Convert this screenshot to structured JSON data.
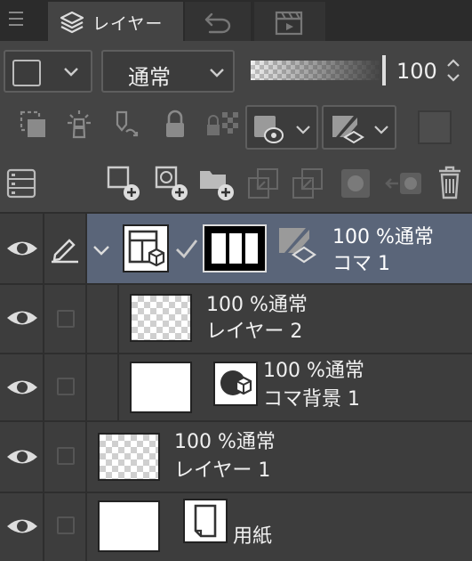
{
  "tabs": [
    {
      "label": "レイヤー",
      "icon": "layers-icon",
      "active": true
    },
    {
      "label": "",
      "icon": "history-icon",
      "active": false
    },
    {
      "label": "",
      "icon": "animation-icon",
      "active": false
    }
  ],
  "blend_mode": "通常",
  "opacity_value": "100",
  "layers": [
    {
      "name": "コマ 1",
      "info": "100 %通常",
      "type": "frame-folder",
      "selected": true
    },
    {
      "name": "レイヤー 2",
      "info": "100 %通常",
      "type": "raster"
    },
    {
      "name": "コマ背景 1",
      "info": "100 %通常",
      "type": "frame-background"
    },
    {
      "name": "レイヤー 1",
      "info": "100 %通常",
      "type": "raster"
    },
    {
      "name": "用紙",
      "info": "",
      "type": "paper"
    }
  ],
  "colors": {
    "selected_row": "#5a6579",
    "panel": "#444444",
    "accent": "#2b2b2b"
  }
}
